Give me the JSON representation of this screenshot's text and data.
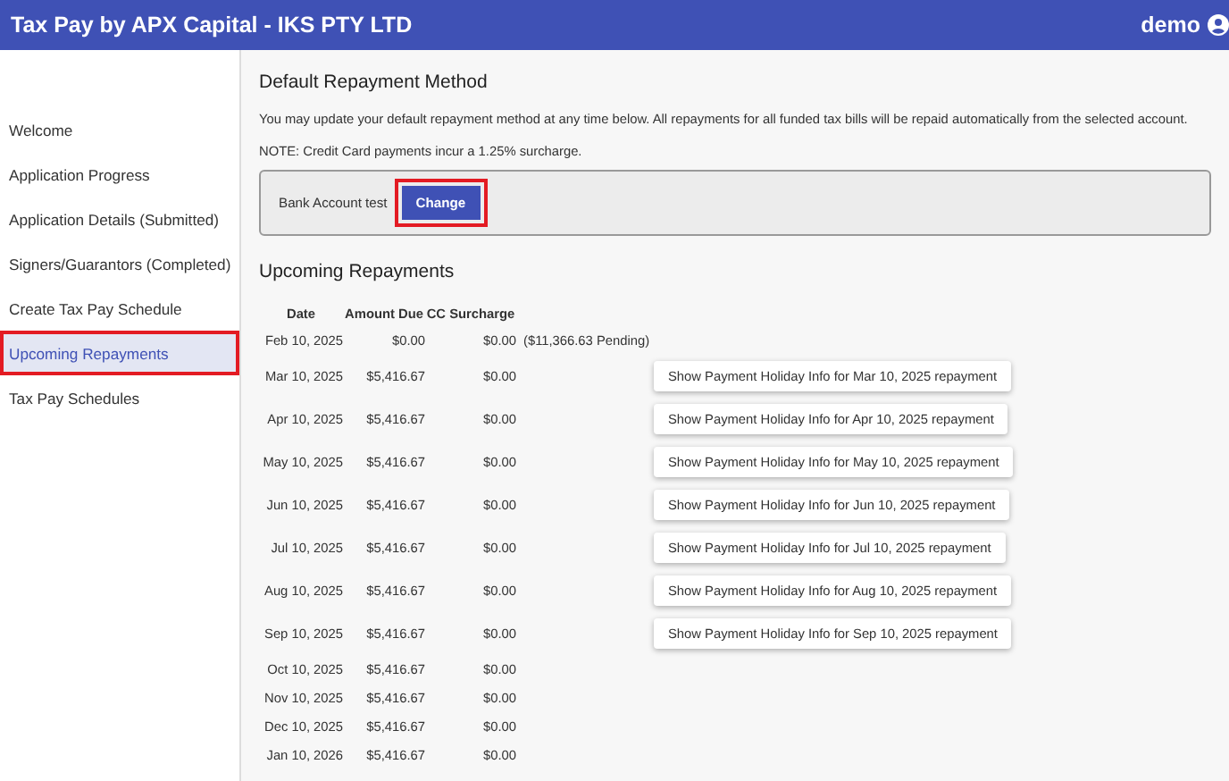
{
  "header": {
    "title": "Tax Pay by APX Capital - IKS PTY LTD",
    "user": "demo"
  },
  "sidebar": {
    "items": [
      {
        "label": "Welcome",
        "selected": false,
        "highlighted": false
      },
      {
        "label": "Application Progress",
        "selected": false,
        "highlighted": false
      },
      {
        "label": "Application Details (Submitted)",
        "selected": false,
        "highlighted": false
      },
      {
        "label": "Signers/Guarantors (Completed)",
        "selected": false,
        "highlighted": false
      },
      {
        "label": "Create Tax Pay Schedule",
        "selected": false,
        "highlighted": false
      },
      {
        "label": "Upcoming Repayments",
        "selected": true,
        "highlighted": true
      },
      {
        "label": "Tax Pay Schedules",
        "selected": false,
        "highlighted": false
      }
    ]
  },
  "repayment_method": {
    "heading": "Default Repayment Method",
    "description": "You may update your default repayment method at any time below. All repayments for all funded tax bills will be repaid automatically from the selected account.",
    "note": "NOTE: Credit Card payments incur a 1.25% surcharge.",
    "account": "Bank Account test",
    "button": {
      "label": "Change",
      "highlighted": true
    }
  },
  "upcoming": {
    "heading": "Upcoming Repayments",
    "columns": [
      "Date",
      "Amount Due",
      "CC Surcharge"
    ],
    "rows": [
      {
        "date": "Feb 10, 2025",
        "amount": "$0.00",
        "surcharge": "$0.00",
        "note": "($11,366.63 Pending)"
      },
      {
        "date": "Mar 10, 2025",
        "amount": "$5,416.67",
        "surcharge": "$0.00",
        "button": "Show Payment Holiday Info for Mar 10, 2025 repayment"
      },
      {
        "date": "Apr 10, 2025",
        "amount": "$5,416.67",
        "surcharge": "$0.00",
        "button": "Show Payment Holiday Info for Apr 10, 2025 repayment"
      },
      {
        "date": "May 10, 2025",
        "amount": "$5,416.67",
        "surcharge": "$0.00",
        "button": "Show Payment Holiday Info for May 10, 2025 repayment"
      },
      {
        "date": "Jun 10, 2025",
        "amount": "$5,416.67",
        "surcharge": "$0.00",
        "button": "Show Payment Holiday Info for Jun 10, 2025 repayment"
      },
      {
        "date": "Jul 10, 2025",
        "amount": "$5,416.67",
        "surcharge": "$0.00",
        "button": "Show Payment Holiday Info for Jul 10, 2025 repayment"
      },
      {
        "date": "Aug 10, 2025",
        "amount": "$5,416.67",
        "surcharge": "$0.00",
        "button": "Show Payment Holiday Info for Aug 10, 2025 repayment"
      },
      {
        "date": "Sep 10, 2025",
        "amount": "$5,416.67",
        "surcharge": "$0.00",
        "button": "Show Payment Holiday Info for Sep 10, 2025 repayment"
      },
      {
        "date": "Oct 10, 2025",
        "amount": "$5,416.67",
        "surcharge": "$0.00"
      },
      {
        "date": "Nov 10, 2025",
        "amount": "$5,416.67",
        "surcharge": "$0.00"
      },
      {
        "date": "Dec 10, 2025",
        "amount": "$5,416.67",
        "surcharge": "$0.00"
      },
      {
        "date": "Jan 10, 2026",
        "amount": "$5,416.67",
        "surcharge": "$0.00"
      }
    ]
  }
}
